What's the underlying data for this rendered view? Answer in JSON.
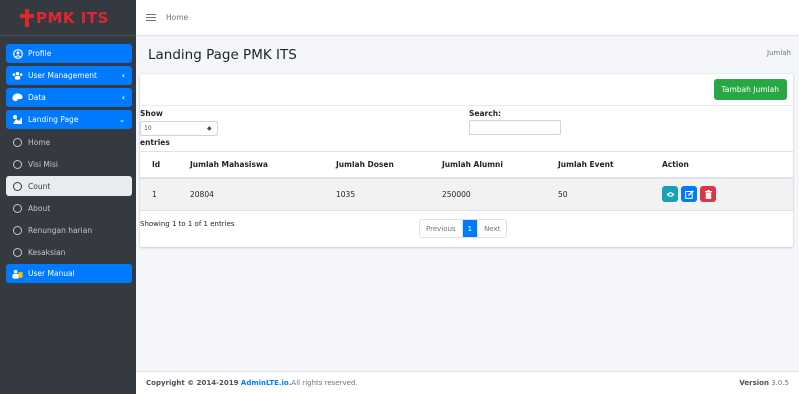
{
  "brand": {
    "name": "PMK ITS",
    "color": "#e3262d"
  },
  "sidebar": {
    "items": [
      {
        "label": "Profile",
        "icon": "user-circle-icon"
      },
      {
        "label": "User Management",
        "icon": "users-icon"
      },
      {
        "label": "Data",
        "icon": "palette-icon"
      },
      {
        "label": "Landing Page",
        "icon": "landing-icon"
      },
      {
        "label": "Home"
      },
      {
        "label": "Visi Misi"
      },
      {
        "label": "Count"
      },
      {
        "label": "About"
      },
      {
        "label": "Renungan harian"
      },
      {
        "label": "Kesaksian"
      },
      {
        "label": "User Manual",
        "icon": "user-manual-icon"
      }
    ]
  },
  "navbar": {
    "home": "Home"
  },
  "header": {
    "title": "Landing Page PMK ITS",
    "breadcrumb": "Jumlah"
  },
  "card": {
    "add_button": "Tambah Jumlah",
    "show_label": "Show",
    "entries_value": "10",
    "entries_label": "entries",
    "search_label": "Search:",
    "columns": [
      "Id",
      "Jumlah Mahasiswa",
      "Jumlah Dosen",
      "Jumlah Alumni",
      "Jumlah Event",
      "Action"
    ],
    "rows": [
      [
        "1",
        "20804",
        "1035",
        "250000",
        "50"
      ]
    ],
    "info": "Showing 1 to 1 of 1 entries",
    "pagination": {
      "previous": "Previous",
      "current": "1",
      "next": "Next"
    }
  },
  "footer": {
    "copyright": "Copyright © 2014-2019 ",
    "link": "AdminLTE.io.",
    "rights": " All rights reserved.",
    "version_label": "Version",
    "version": "3.0.5"
  },
  "colors": {
    "primary": "#007bff",
    "success": "#28a745",
    "info": "#17a2b8",
    "danger": "#dc3545",
    "sidebar": "#343a40"
  }
}
